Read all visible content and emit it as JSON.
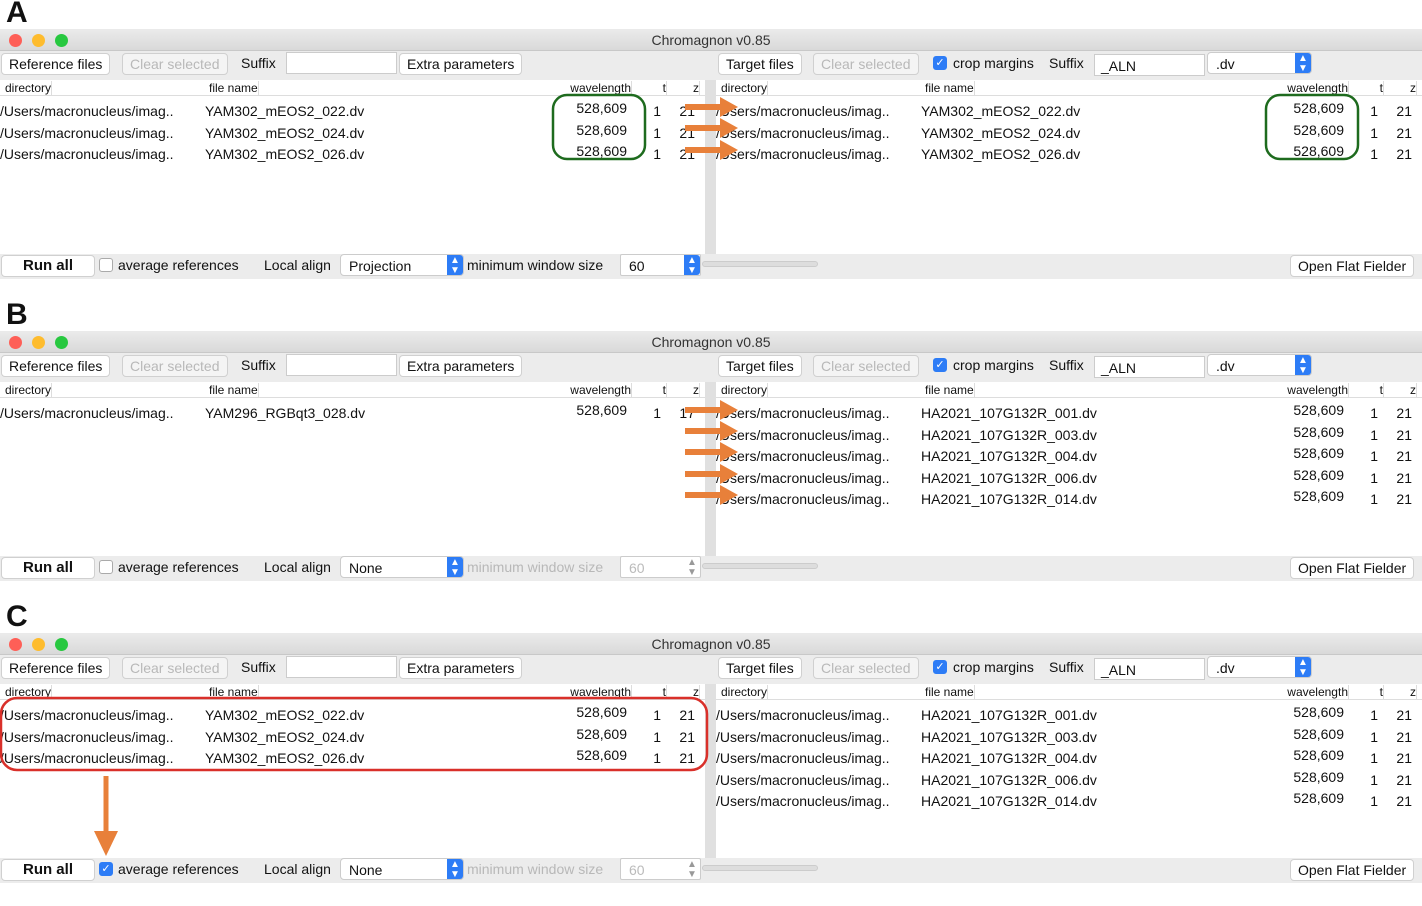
{
  "window_title": "Chromagnon v0.85",
  "colors": {
    "accent": "#2d7cf6",
    "arrow": "#e8803a",
    "highlight_green": "#1e6b1e",
    "highlight_red": "#d9302a"
  },
  "toolbar": {
    "reference_files": "Reference files",
    "clear_selected": "Clear selected",
    "suffix_label": "Suffix",
    "extra_parameters": "Extra parameters",
    "target_files": "Target files",
    "crop_margins": "crop margins",
    "target_suffix_value": "_ALN",
    "extension_value": ".dv"
  },
  "columns": {
    "directory": "directory",
    "file_name": "file name",
    "wavelength": "wavelength",
    "t": "t",
    "z": "z"
  },
  "bottom": {
    "run_all": "Run all",
    "average_references": "average references",
    "local_align": "Local align",
    "minimum_window_size": "minimum window size",
    "open_flat_fielder": "Open Flat Fielder"
  },
  "panels": [
    {
      "letter": "A",
      "local_align_value": "Projection",
      "min_window_value": "60",
      "min_window_enabled": true,
      "average_references_checked": false,
      "reference_rows": [
        {
          "directory": "/Users/macronucleus/imag..",
          "file_name": "YAM302_mEOS2_022.dv",
          "wavelength": "528,609",
          "t": "1",
          "z": "21"
        },
        {
          "directory": "/Users/macronucleus/imag..",
          "file_name": "YAM302_mEOS2_024.dv",
          "wavelength": "528,609",
          "t": "1",
          "z": "21"
        },
        {
          "directory": "/Users/macronucleus/imag..",
          "file_name": "YAM302_mEOS2_026.dv",
          "wavelength": "528,609",
          "t": "1",
          "z": "21"
        }
      ],
      "target_rows": [
        {
          "directory": "/Users/macronucleus/imag..",
          "file_name": "YAM302_mEOS2_022.dv",
          "wavelength": "528,609",
          "t": "1",
          "z": "21"
        },
        {
          "directory": "/Users/macronucleus/imag..",
          "file_name": "YAM302_mEOS2_024.dv",
          "wavelength": "528,609",
          "t": "1",
          "z": "21"
        },
        {
          "directory": "/Users/macronucleus/imag..",
          "file_name": "YAM302_mEOS2_026.dv",
          "wavelength": "528,609",
          "t": "1",
          "z": "21"
        }
      ]
    },
    {
      "letter": "B",
      "local_align_value": "None",
      "min_window_value": "60",
      "min_window_enabled": false,
      "average_references_checked": false,
      "reference_rows": [
        {
          "directory": "/Users/macronucleus/imag..",
          "file_name": "YAM296_RGBqt3_028.dv",
          "wavelength": "528,609",
          "t": "1",
          "z": "17"
        }
      ],
      "target_rows": [
        {
          "directory": "/Users/macronucleus/imag..",
          "file_name": "HA2021_107G132R_001.dv",
          "wavelength": "528,609",
          "t": "1",
          "z": "21"
        },
        {
          "directory": "/Users/macronucleus/imag..",
          "file_name": "HA2021_107G132R_003.dv",
          "wavelength": "528,609",
          "t": "1",
          "z": "21"
        },
        {
          "directory": "/Users/macronucleus/imag..",
          "file_name": "HA2021_107G132R_004.dv",
          "wavelength": "528,609",
          "t": "1",
          "z": "21"
        },
        {
          "directory": "/Users/macronucleus/imag..",
          "file_name": "HA2021_107G132R_006.dv",
          "wavelength": "528,609",
          "t": "1",
          "z": "21"
        },
        {
          "directory": "/Users/macronucleus/imag..",
          "file_name": "HA2021_107G132R_014.dv",
          "wavelength": "528,609",
          "t": "1",
          "z": "21"
        }
      ]
    },
    {
      "letter": "C",
      "local_align_value": "None",
      "min_window_value": "60",
      "min_window_enabled": false,
      "average_references_checked": true,
      "reference_rows": [
        {
          "directory": "/Users/macronucleus/imag..",
          "file_name": "YAM302_mEOS2_022.dv",
          "wavelength": "528,609",
          "t": "1",
          "z": "21"
        },
        {
          "directory": "/Users/macronucleus/imag..",
          "file_name": "YAM302_mEOS2_024.dv",
          "wavelength": "528,609",
          "t": "1",
          "z": "21"
        },
        {
          "directory": "/Users/macronucleus/imag..",
          "file_name": "YAM302_mEOS2_026.dv",
          "wavelength": "528,609",
          "t": "1",
          "z": "21"
        }
      ],
      "target_rows": [
        {
          "directory": "/Users/macronucleus/imag..",
          "file_name": "HA2021_107G132R_001.dv",
          "wavelength": "528,609",
          "t": "1",
          "z": "21"
        },
        {
          "directory": "/Users/macronucleus/imag..",
          "file_name": "HA2021_107G132R_003.dv",
          "wavelength": "528,609",
          "t": "1",
          "z": "21"
        },
        {
          "directory": "/Users/macronucleus/imag..",
          "file_name": "HA2021_107G132R_004.dv",
          "wavelength": "528,609",
          "t": "1",
          "z": "21"
        },
        {
          "directory": "/Users/macronucleus/imag..",
          "file_name": "HA2021_107G132R_006.dv",
          "wavelength": "528,609",
          "t": "1",
          "z": "21"
        },
        {
          "directory": "/Users/macronucleus/imag..",
          "file_name": "HA2021_107G132R_014.dv",
          "wavelength": "528,609",
          "t": "1",
          "z": "21"
        }
      ]
    }
  ]
}
